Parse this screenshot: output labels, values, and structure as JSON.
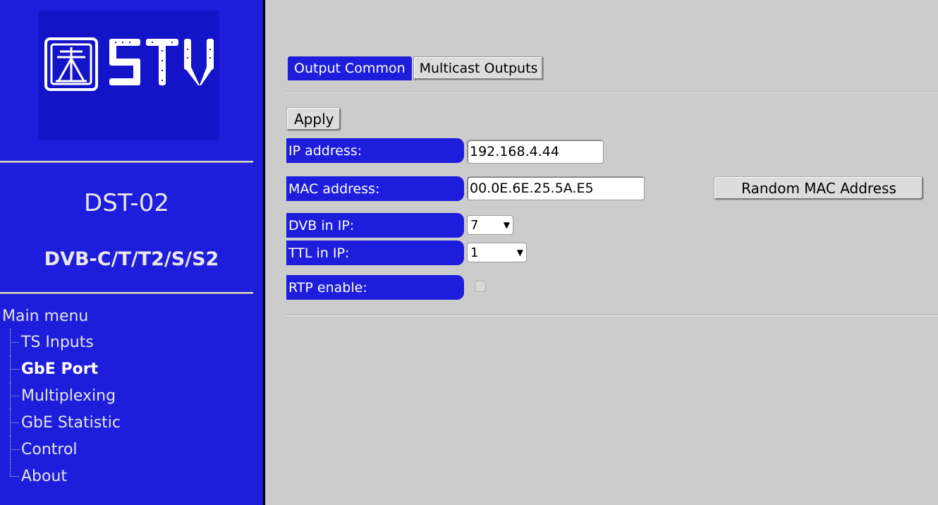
{
  "sidebar": {
    "logo_text": "STV",
    "device_name": "DST-02",
    "device_modes": "DVB-C/T/T2/S/S2",
    "menu_title": "Main menu",
    "menu_items": [
      {
        "label": "TS Inputs"
      },
      {
        "label": "GbE Port"
      },
      {
        "label": "Multiplexing"
      },
      {
        "label": "GbE Statistic"
      },
      {
        "label": "Control"
      },
      {
        "label": "About"
      }
    ],
    "active_item": "GbE Port"
  },
  "main": {
    "tabs": [
      {
        "label": "Output Common",
        "active": true
      },
      {
        "label": "Multicast Outputs",
        "active": false
      }
    ],
    "apply_label": "Apply",
    "fields": {
      "ip_label": "IP address:",
      "ip_value": "192.168.4.44",
      "mac_label": "MAC address:",
      "mac_value": "00.0E.6E.25.5A.E5",
      "random_mac_label": "Random MAC Address",
      "dvb_label": "DVB in IP:",
      "dvb_value": "7",
      "ttl_label": "TTL in IP:",
      "ttl_value": "1",
      "rtp_label": "RTP enable:",
      "rtp_checked": false
    }
  },
  "colors": {
    "accent_blue": "#1d1ddb",
    "background_gray": "#cccccc"
  }
}
